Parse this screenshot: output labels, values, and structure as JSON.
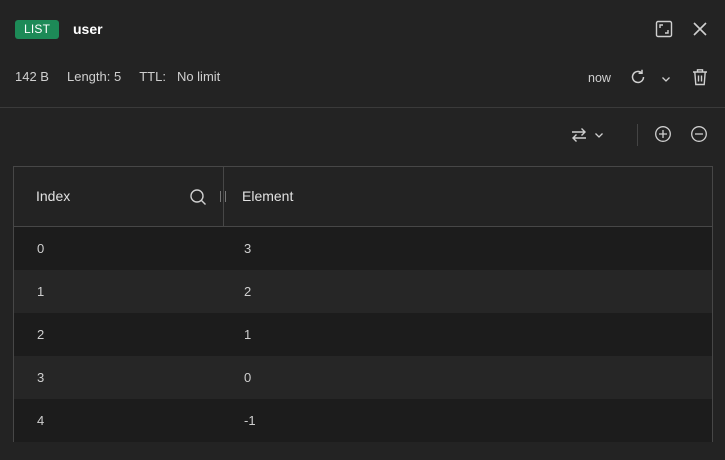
{
  "header": {
    "type_badge": "LIST",
    "key_name": "user",
    "size": "142 B",
    "length": "Length: 5",
    "ttl_label": "TTL:",
    "ttl_value": "No limit",
    "last_refresh": "now"
  },
  "icons": {
    "fullscreen": "fullscreen-icon",
    "close": "close-icon",
    "refresh": "refresh-icon",
    "chevron": "chevron-down-icon",
    "delete": "trash-icon",
    "swap": "swap-icon",
    "add": "plus-circle-icon",
    "remove": "minus-circle-icon",
    "search": "search-icon"
  },
  "colors": {
    "badge": "#1d8a57",
    "background": "#232323",
    "border": "#474747"
  },
  "table": {
    "columns": [
      "Index",
      "Element"
    ],
    "rows": [
      {
        "index": "0",
        "element": "3"
      },
      {
        "index": "1",
        "element": "2"
      },
      {
        "index": "2",
        "element": "1"
      },
      {
        "index": "3",
        "element": "0"
      },
      {
        "index": "4",
        "element": "-1"
      }
    ]
  }
}
